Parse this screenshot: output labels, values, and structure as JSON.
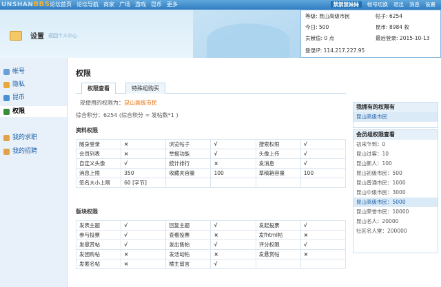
{
  "topbar": {
    "logo_prefix": "UNSHAN",
    "logo_bbs": "BBS",
    "nav": [
      "论坛首页",
      "论坛导航",
      "商家",
      "广场",
      "游戏",
      "昆币",
      "更多"
    ],
    "username": "禁禁禁妹妹",
    "links": [
      "帐号切换",
      "退出",
      "消息",
      "设置"
    ]
  },
  "banner": {
    "title": "设置",
    "subtitle": "返回个人中心"
  },
  "popup": {
    "level_label": "等级:",
    "level_value": "昆山高级市民",
    "posts_label": "帖子:",
    "posts_value": "6254",
    "today_label": "今日:",
    "today_value": "500",
    "coins_label": "昆币:",
    "coins_value": "8984 枚",
    "contrib_label": "贡献值:",
    "contrib_value": "0 点",
    "lastlogin_label": "最后登录:",
    "lastlogin_value": "2015-10-13",
    "ip_label": "登录IP:",
    "ip_value": "114.217.227.95"
  },
  "sidebar": {
    "items": [
      {
        "label": "帐号",
        "icon": "account-icon",
        "color": "#6a9ed6"
      },
      {
        "label": "隐私",
        "icon": "lock-icon",
        "color": "#e7a93a"
      },
      {
        "label": "昆币",
        "icon": "coin-icon",
        "color": "#4b8fd4"
      },
      {
        "label": "权限",
        "icon": "permission-icon",
        "color": "#3b8c3b"
      },
      {
        "label": "我的求职",
        "icon": "job-icon",
        "color": "#e0a34a"
      },
      {
        "label": "我的招聘",
        "icon": "recruit-icon",
        "color": "#e0a34a"
      }
    ]
  },
  "main": {
    "title": "权限",
    "tabs": [
      "权限查看",
      "特殊组购买"
    ],
    "current_level_prefix": "现使用的权限为：",
    "current_level": "昆山高级市民",
    "points_text": "综合积分：6254    (综合积分 = 发帖数*1 )",
    "section1_title": "资料权限",
    "section2_title": "版块权限",
    "table1": [
      [
        "随身登录",
        "no",
        "浏览帖子",
        "yes",
        "搜索权限",
        "yes"
      ],
      [
        "会员列表",
        "no",
        "举报功能",
        "yes",
        "头像上传",
        "yes"
      ],
      [
        "自定义头像",
        "yes",
        "统计排行",
        "no",
        "发消息",
        "yes"
      ],
      [
        "消息上限",
        "350",
        "收藏夹容量",
        "100",
        "草稿箱容量",
        "100"
      ],
      [
        "签名大小上限",
        "60 [字节]",
        "",
        "",
        "",
        ""
      ]
    ],
    "table2": [
      [
        "发表主题",
        "yes",
        "回复主题",
        "yes",
        "发起投票",
        "yes"
      ],
      [
        "参与投票",
        "yes",
        "查看投票",
        "no",
        "发fhtml帖",
        "no"
      ],
      [
        "发悬赏帖",
        "yes",
        "发出售帖",
        "yes",
        "评分权限",
        "yes"
      ],
      [
        "发团购帖",
        "no",
        "发活动帖",
        "no",
        "发悬赏帖",
        "no"
      ],
      [
        "发匿名帖",
        "no",
        "楼主留言",
        "yes",
        "",
        ""
      ]
    ]
  },
  "right": {
    "my_perms_title": "我拥有的权限有",
    "my_perms_item": "昆山高级市民",
    "group_title": "会员组权限查看",
    "groups": [
      "初来乍到：0",
      "昆山过客：10",
      "昆山新人：100",
      "昆山初级市民：500",
      "昆山普通市民：1000",
      "昆山中级市民：3000",
      "昆山高级市民：5000",
      "昆山荣誉市民：10000",
      "昆山名人：20000",
      "社区名人堂：200000"
    ],
    "highlight_index": 6
  }
}
